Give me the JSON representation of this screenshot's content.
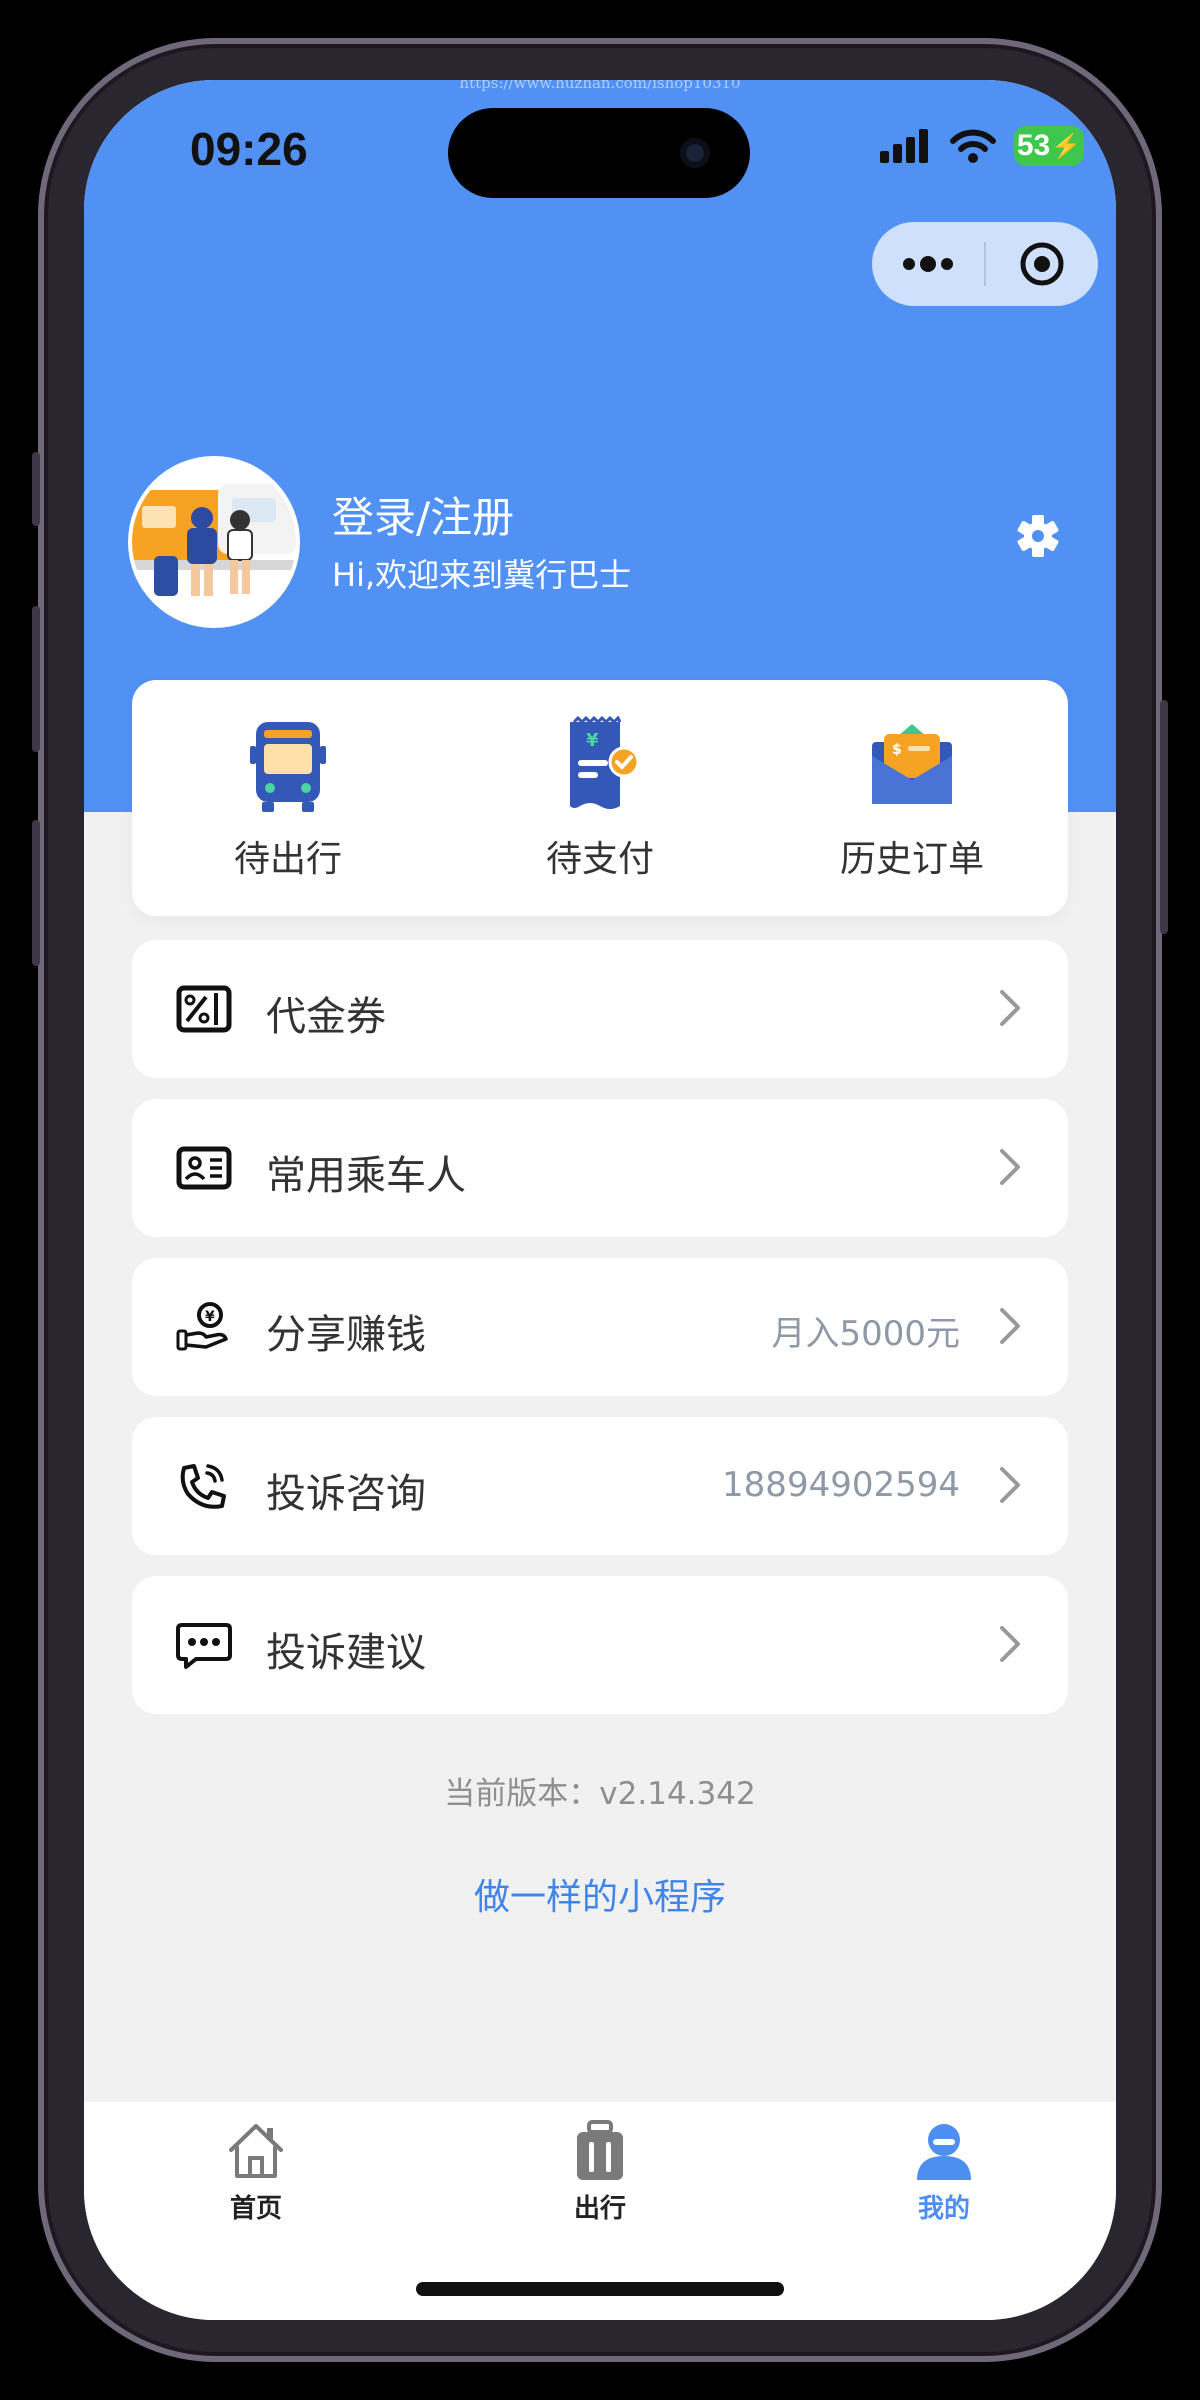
{
  "watermark": "https://www.huzhan.com/ishop10310",
  "status_bar": {
    "time": "09:26",
    "battery": "53"
  },
  "capsule": {
    "more_icon": "more-dots-icon",
    "close_icon": "target-icon"
  },
  "profile": {
    "title": "登录/注册",
    "welcome": "Hi,欢迎来到冀行巴士",
    "settings_icon": "gear-icon"
  },
  "orders": [
    {
      "label": "待出行",
      "icon": "bus-icon"
    },
    {
      "label": "待支付",
      "icon": "receipt-icon"
    },
    {
      "label": "历史订单",
      "icon": "envelope-icon"
    }
  ],
  "menu": [
    {
      "label": "代金券",
      "value": "",
      "icon": "coupon-icon"
    },
    {
      "label": "常用乘车人",
      "value": "",
      "icon": "id-card-icon"
    },
    {
      "label": "分享赚钱",
      "value": "月入5000元",
      "icon": "money-hand-icon"
    },
    {
      "label": "投诉咨询",
      "value": "18894902594",
      "icon": "phone-icon"
    },
    {
      "label": "投诉建议",
      "value": "",
      "icon": "chat-icon"
    }
  ],
  "footer": {
    "version": "当前版本：v2.14.342",
    "link": "做一样的小程序"
  },
  "tabbar": [
    {
      "label": "首页",
      "icon": "home-icon",
      "active": false
    },
    {
      "label": "出行",
      "icon": "luggage-icon",
      "active": false
    },
    {
      "label": "我的",
      "icon": "user-icon",
      "active": true
    }
  ],
  "colors": {
    "primary": "#5191f4",
    "link": "#3f86e8",
    "background": "#f1f1f1"
  }
}
